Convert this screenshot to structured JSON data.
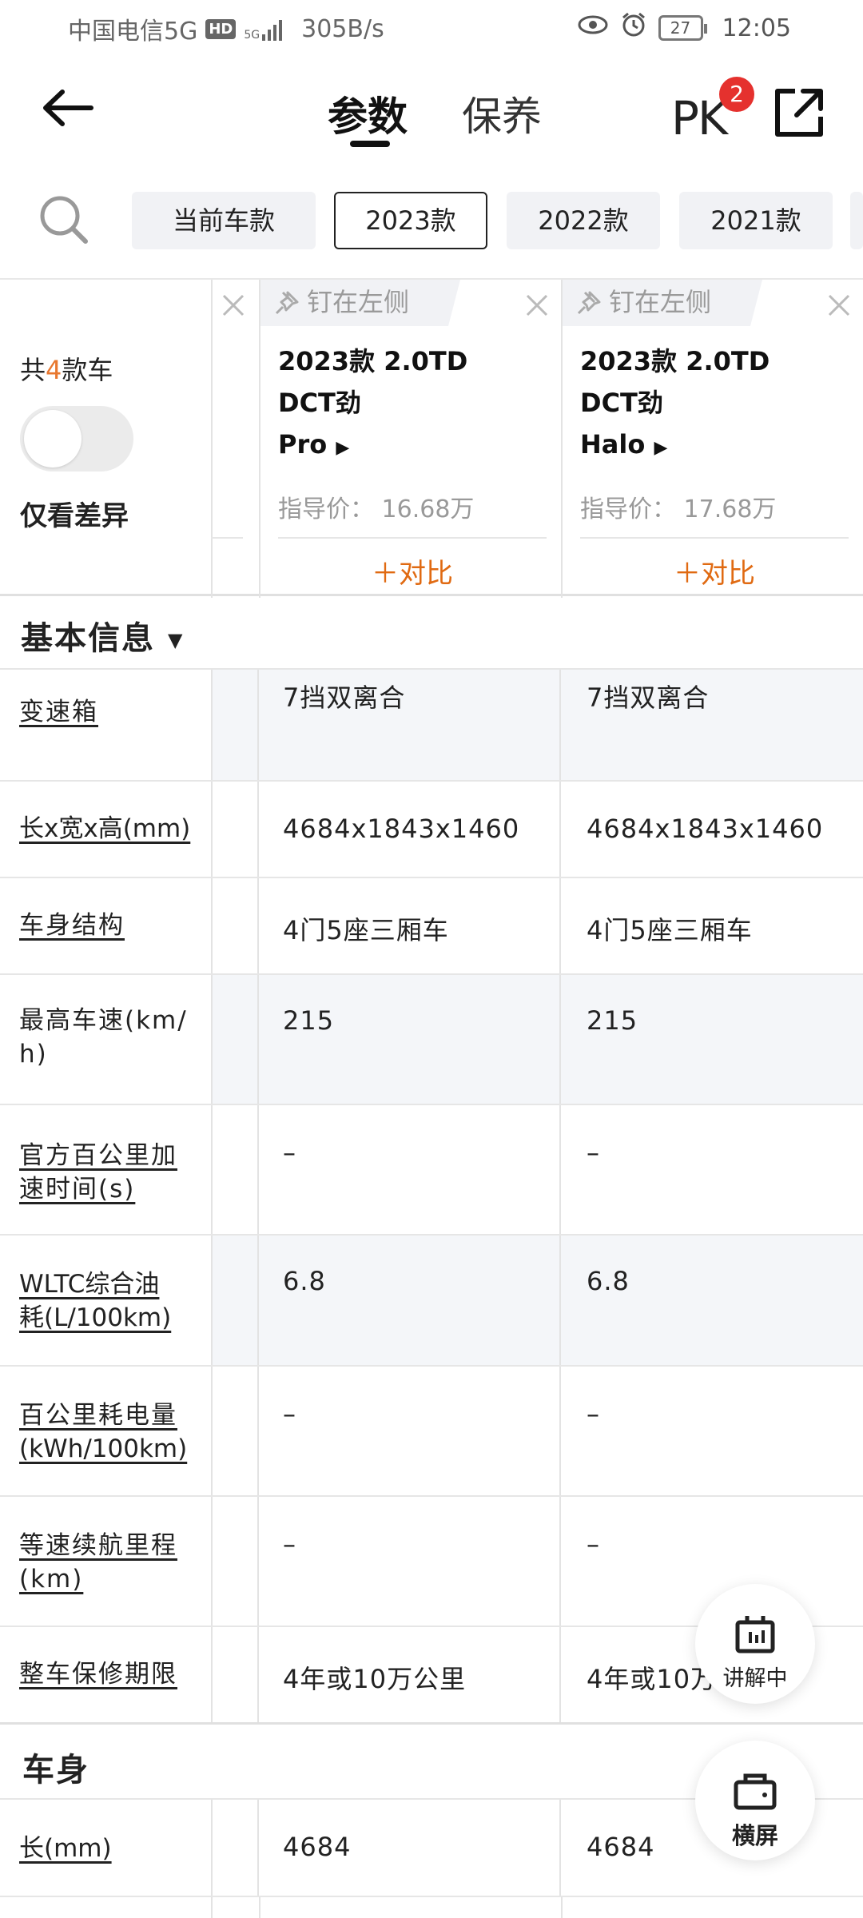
{
  "status_bar": {
    "carrier": "中国电信5G",
    "hd": "HD",
    "signal_small": "5G",
    "speed": "305B/s",
    "battery": "27",
    "time": "12:05"
  },
  "header": {
    "tabs": [
      {
        "label": "参数",
        "active": true
      },
      {
        "label": "保养",
        "active": false
      }
    ],
    "pk_label": "PK",
    "pk_badge": "2"
  },
  "filters": {
    "chips": [
      {
        "label": "当前车款",
        "active": false
      },
      {
        "label": "2023款",
        "active": true
      },
      {
        "label": "2022款",
        "active": false
      },
      {
        "label": "2021款",
        "active": false
      }
    ]
  },
  "compare_panel": {
    "count_prefix": "共",
    "count": "4",
    "count_suffix": "款车",
    "diff_only_label": "仅看差异",
    "diff_only_on": false,
    "cars": [
      {
        "pin_label": "钉在左侧",
        "name_line1": "2023款 2.0TD DCT劲",
        "name_line2": "Pro",
        "price": "指导价： 16.68万",
        "compare_label": "＋对比"
      },
      {
        "pin_label": "钉在左侧",
        "name_line1": "2023款 2.0TD DCT劲",
        "name_line2": "Halo",
        "price": "指导价： 17.68万",
        "compare_label": "＋对比"
      }
    ]
  },
  "sections": {
    "basic_info": {
      "title": "基本信息",
      "rows": [
        {
          "label": "变速箱",
          "v1": "7挡双离合",
          "v2": "7挡双离合"
        },
        {
          "label": "长x宽x高(mm)",
          "v1": "4684x1843x1460",
          "v2": "4684x1843x1460"
        },
        {
          "label": "车身结构",
          "v1": "4门5座三厢车",
          "v2": "4门5座三厢车"
        },
        {
          "label_l1": "最高车速(km/",
          "label_l2": "h)",
          "v1": "215",
          "v2": "215"
        },
        {
          "label_l1": "官方百公里加",
          "label_l2": "速时间(s)",
          "v1": "–",
          "v2": "–"
        },
        {
          "label_l1": "WLTC综合油",
          "label_l2": "耗(L/100km)",
          "v1": "6.8",
          "v2": "6.8"
        },
        {
          "label_l1": "百公里耗电量",
          "label_l2": "(kWh/100km)",
          "v1": "–",
          "v2": "–"
        },
        {
          "label_l1": "等速续航里程",
          "label_l2": "(km)",
          "v1": "–",
          "v2": "–"
        },
        {
          "label": "整车保修期限",
          "v1": "4年或10万公里",
          "v2": "4年或10万公里"
        }
      ]
    },
    "body": {
      "title": "车身",
      "rows": [
        {
          "label": "长(mm)",
          "v1": "4684",
          "v2": "4684"
        }
      ]
    }
  },
  "floating": {
    "explain_label": "讲解中",
    "landscape_label": "横屏"
  }
}
